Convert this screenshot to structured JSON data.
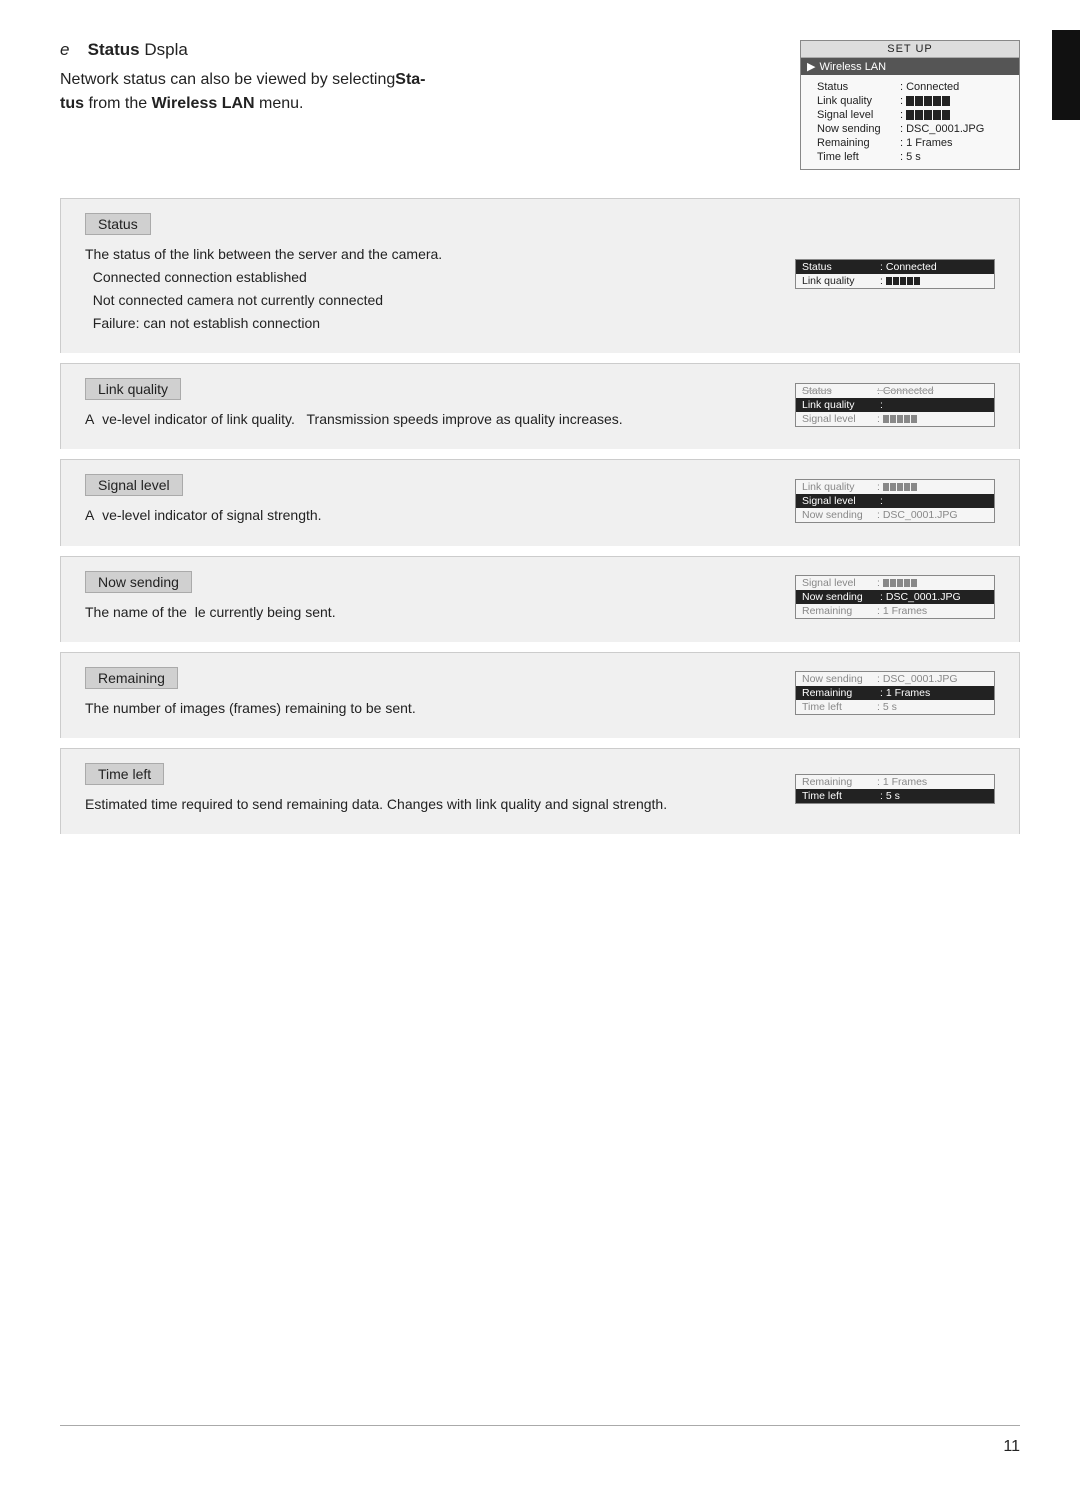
{
  "page": {
    "number": "11"
  },
  "header": {
    "letter": "e",
    "title_bold": "Status",
    "title_rest": " Dspla",
    "desc_line1": "Network status can also be viewed by selecting",
    "desc_bold1": "Sta-",
    "desc_line2": "tus",
    "desc_rest": " from the ",
    "desc_bold2": "Wireless LAN",
    "desc_end": " menu."
  },
  "camera_display": {
    "header": "SET  UP",
    "menu": "Wireless LAN",
    "rows": [
      {
        "label": "Status",
        "colon": ":",
        "value": "Connected"
      },
      {
        "label": "Link quality",
        "colon": ":",
        "value": "bars"
      },
      {
        "label": "Signal level",
        "colon": ":",
        "value": "bars"
      },
      {
        "label": "Now sending",
        "colon": ":",
        "value": "DSC_0001.JPG"
      },
      {
        "label": "Remaining",
        "colon": ":",
        "value": "1 Frames"
      },
      {
        "label": "Time left",
        "colon": ":",
        "value": "5 s"
      }
    ]
  },
  "sections": [
    {
      "id": "status",
      "label": "Status",
      "body": "The status of the link between the server and the camera.\n  Connected connection established\n  Not connected camera not currently connected\n  Failure: can not establish connection",
      "screenshot": {
        "type": "status",
        "rows": [
          {
            "label": "Status",
            "colon": ":",
            "value": "Connected",
            "highlight": true
          },
          {
            "label": "Link quality",
            "colon": ":",
            "value": "bars",
            "highlight": false
          }
        ]
      }
    },
    {
      "id": "link-quality",
      "label": "Link quality",
      "body": "A  ve-level indicator of link quality.   Transmission speeds improve as quality increases.",
      "screenshot": {
        "type": "link-quality",
        "rows": [
          {
            "label": "Status",
            "colon": ":",
            "value": "Connected",
            "blur": true
          },
          {
            "label": "Link quality",
            "colon": ":",
            "value": "bars",
            "highlight": true
          },
          {
            "label": "Signal level",
            "colon": ":",
            "value": "bars",
            "blur": true
          }
        ]
      }
    },
    {
      "id": "signal-level",
      "label": "Signal level",
      "body": "A  ve-level indicator of signal strength.",
      "screenshot": {
        "type": "signal-level",
        "rows": [
          {
            "label": "Link quality",
            "colon": ":",
            "value": "bars",
            "blur": true
          },
          {
            "label": "Signal level",
            "colon": ":",
            "value": "bars",
            "highlight": true
          },
          {
            "label": "Now sending",
            "colon": ":",
            "value": "DSC_0001.JPG",
            "blur": true
          }
        ]
      }
    },
    {
      "id": "now-sending",
      "label": "Now sending",
      "body": "The name of the  le currently being sent.",
      "screenshot": {
        "type": "now-sending",
        "rows": [
          {
            "label": "Signal level",
            "colon": ":",
            "value": "bars",
            "blur": true
          },
          {
            "label": "Now sending",
            "colon": ":",
            "value": "DSC_0001.JPG",
            "highlight": true
          },
          {
            "label": "Remaining",
            "colon": ":",
            "value": "1 Frames",
            "blur": true
          }
        ]
      }
    },
    {
      "id": "remaining",
      "label": "Remaining",
      "body": "The number of images (frames) remaining to be sent.",
      "screenshot": {
        "type": "remaining",
        "rows": [
          {
            "label": "Now sending",
            "colon": ":",
            "value": "DSC_0001.JPG",
            "blur": true
          },
          {
            "label": "Remaining",
            "colon": ":",
            "value": "1 Frames",
            "highlight": true
          },
          {
            "label": "Time left",
            "colon": ":",
            "value": "5 s",
            "blur": true
          }
        ]
      }
    },
    {
      "id": "time-left",
      "label": "Time left",
      "body": "Estimated time required to send remaining data. Changes with link quality and signal strength.",
      "screenshot": {
        "type": "time-left",
        "rows": [
          {
            "label": "Remaining",
            "colon": ":",
            "value": "1 Frames",
            "blur": true
          },
          {
            "label": "Time left",
            "colon": ":",
            "value": "5 s",
            "highlight": true
          }
        ]
      }
    }
  ]
}
